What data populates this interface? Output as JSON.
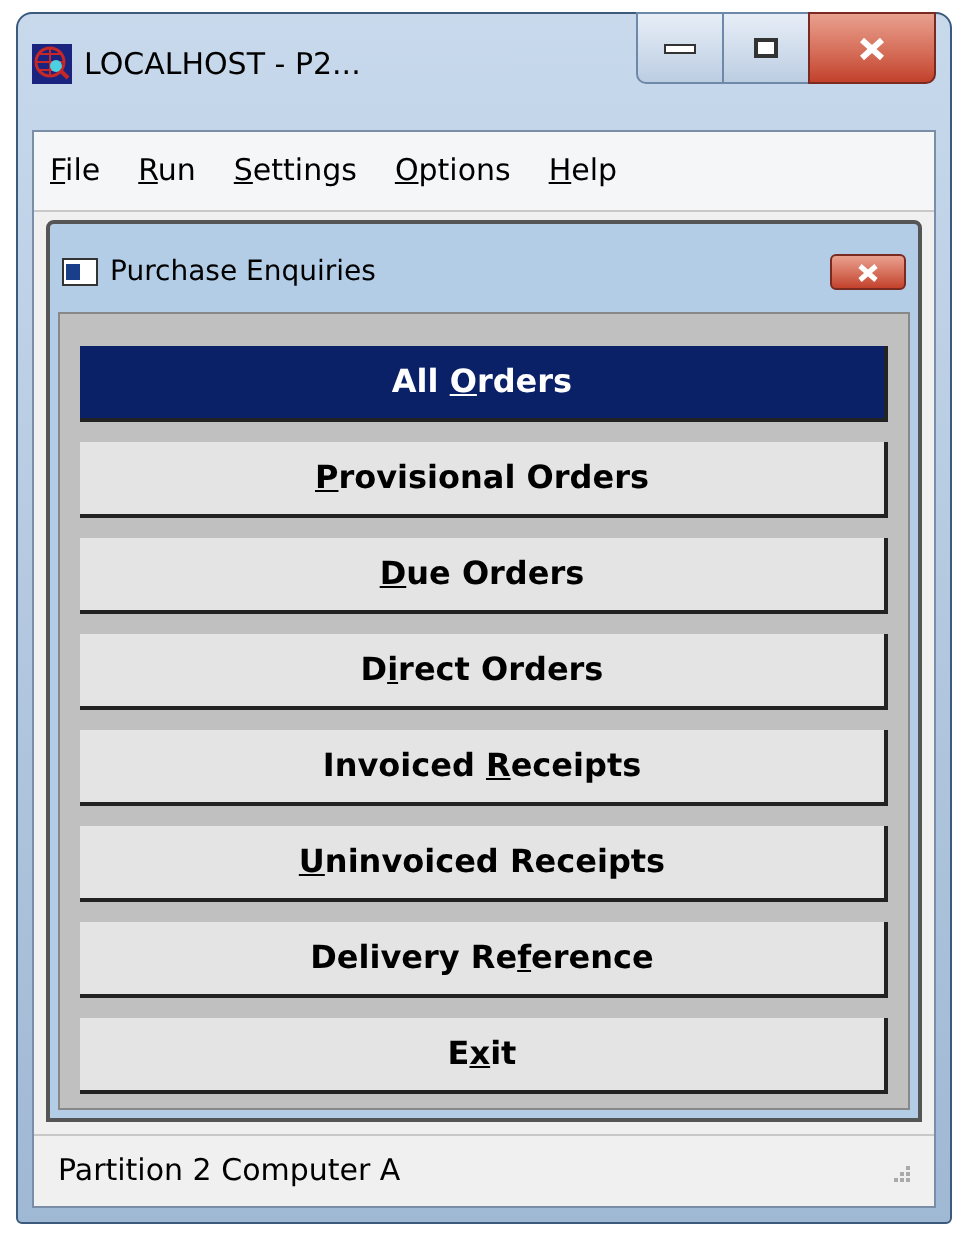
{
  "window": {
    "title": "LOCALHOST - P2..."
  },
  "menu": [
    {
      "key": "F",
      "rest": "ile"
    },
    {
      "key": "R",
      "rest": "un"
    },
    {
      "key": "S",
      "rest": "ettings"
    },
    {
      "key": "O",
      "rest": "ptions"
    },
    {
      "key": "H",
      "rest": "elp"
    }
  ],
  "dialog": {
    "title": "Purchase Enquiries"
  },
  "buttons": [
    {
      "before": "All ",
      "key": "O",
      "after": "rders",
      "selected": true
    },
    {
      "key": "P",
      "after": "rovisional Orders",
      "selected": false
    },
    {
      "key": "D",
      "after": "ue Orders",
      "selected": false
    },
    {
      "before": "D",
      "key": "i",
      "after": "rect Orders",
      "selected": false
    },
    {
      "before": "Invoiced ",
      "key": "R",
      "after": "eceipts",
      "selected": false
    },
    {
      "key": "U",
      "after": "ninvoiced Receipts",
      "selected": false
    },
    {
      "before": "Delivery Re",
      "key": "f",
      "after": "erence",
      "selected": false
    },
    {
      "before": "E",
      "key": "x",
      "after": "it",
      "selected": false
    }
  ],
  "status_bar": {
    "text": "Partition 2 Computer A"
  }
}
